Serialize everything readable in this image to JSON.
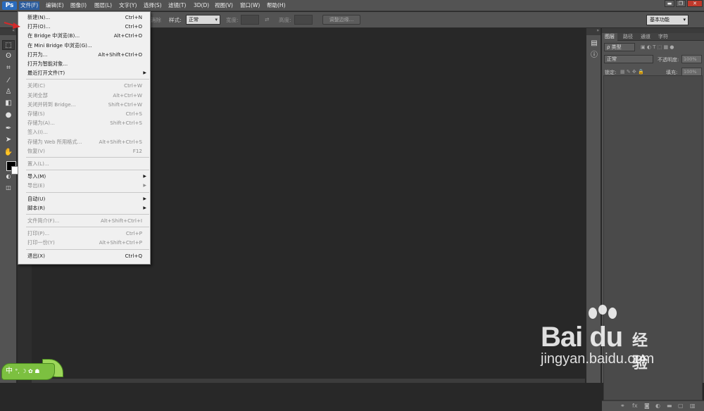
{
  "app": {
    "logo": "Ps"
  },
  "menubar": {
    "items": [
      "文件(F)",
      "编辑(E)",
      "图像(I)",
      "图层(L)",
      "文字(Y)",
      "选择(S)",
      "滤镜(T)",
      "3D(D)",
      "视图(V)",
      "窗口(W)",
      "帮助(H)"
    ],
    "active_index": 0
  },
  "window_controls": {
    "minimize": "▬",
    "restore": "❐",
    "close": "✕"
  },
  "options_bar": {
    "faded_label": "消除",
    "style_label": "样式:",
    "style_value": "正常",
    "width_label": "宽度:",
    "height_label": "高度:",
    "refine_edge_button": "调整边缘...",
    "workspace": "基本功能"
  },
  "file_menu": {
    "items": [
      {
        "label": "新建(N)...",
        "shortcut": "Ctrl+N",
        "enabled": true
      },
      {
        "label": "打开(O)...",
        "shortcut": "Ctrl+O",
        "enabled": true
      },
      {
        "label": "在 Bridge 中浏览(B)...",
        "shortcut": "Alt+Ctrl+O",
        "enabled": true
      },
      {
        "label": "在 Mini Bridge 中浏览(G)...",
        "shortcut": "",
        "enabled": true
      },
      {
        "label": "打开为...",
        "shortcut": "Alt+Shift+Ctrl+O",
        "enabled": true
      },
      {
        "label": "打开为智能对象...",
        "shortcut": "",
        "enabled": true
      },
      {
        "label": "最近打开文件(T)",
        "shortcut": "",
        "enabled": true,
        "submenu": true
      },
      {
        "separator": true
      },
      {
        "label": "关闭(C)",
        "shortcut": "Ctrl+W",
        "enabled": false
      },
      {
        "label": "关闭全部",
        "shortcut": "Alt+Ctrl+W",
        "enabled": false
      },
      {
        "label": "关闭并转到 Bridge...",
        "shortcut": "Shift+Ctrl+W",
        "enabled": false
      },
      {
        "label": "存储(S)",
        "shortcut": "Ctrl+S",
        "enabled": false
      },
      {
        "label": "存储为(A)...",
        "shortcut": "Shift+Ctrl+S",
        "enabled": false
      },
      {
        "label": "签入(I)...",
        "shortcut": "",
        "enabled": false
      },
      {
        "label": "存储为 Web 所用格式...",
        "shortcut": "Alt+Shift+Ctrl+S",
        "enabled": false
      },
      {
        "label": "恢复(V)",
        "shortcut": "F12",
        "enabled": false
      },
      {
        "separator": true
      },
      {
        "label": "置入(L)...",
        "shortcut": "",
        "enabled": false
      },
      {
        "separator": true
      },
      {
        "label": "导入(M)",
        "shortcut": "",
        "enabled": true,
        "submenu": true
      },
      {
        "label": "导出(E)",
        "shortcut": "",
        "enabled": false,
        "submenu": true
      },
      {
        "separator": true
      },
      {
        "label": "自动(U)",
        "shortcut": "",
        "enabled": true,
        "submenu": true
      },
      {
        "label": "脚本(R)",
        "shortcut": "",
        "enabled": true,
        "submenu": true
      },
      {
        "separator": true
      },
      {
        "label": "文件简介(F)...",
        "shortcut": "Alt+Shift+Ctrl+I",
        "enabled": false
      },
      {
        "separator": true
      },
      {
        "label": "打印(P)...",
        "shortcut": "Ctrl+P",
        "enabled": false
      },
      {
        "label": "打印一份(Y)",
        "shortcut": "Alt+Shift+Ctrl+P",
        "enabled": false
      },
      {
        "separator": true
      },
      {
        "label": "退出(X)",
        "shortcut": "Ctrl+Q",
        "enabled": true
      }
    ]
  },
  "layers_panel": {
    "tabs": [
      "图层",
      "路径",
      "通道",
      "字符"
    ],
    "filter_kind": "ρ 类型",
    "blend_mode": "正常",
    "opacity_label": "不透明度:",
    "opacity_value": "100%",
    "lock_label": "锁定:",
    "fill_label": "填充:",
    "fill_value": "100%"
  },
  "watermark": {
    "brand": "Bai du",
    "product": "经验",
    "url": "jingyan.baidu.com"
  },
  "ime": {
    "text": "中",
    "icons": "°, ☽ ✿ ☗"
  }
}
